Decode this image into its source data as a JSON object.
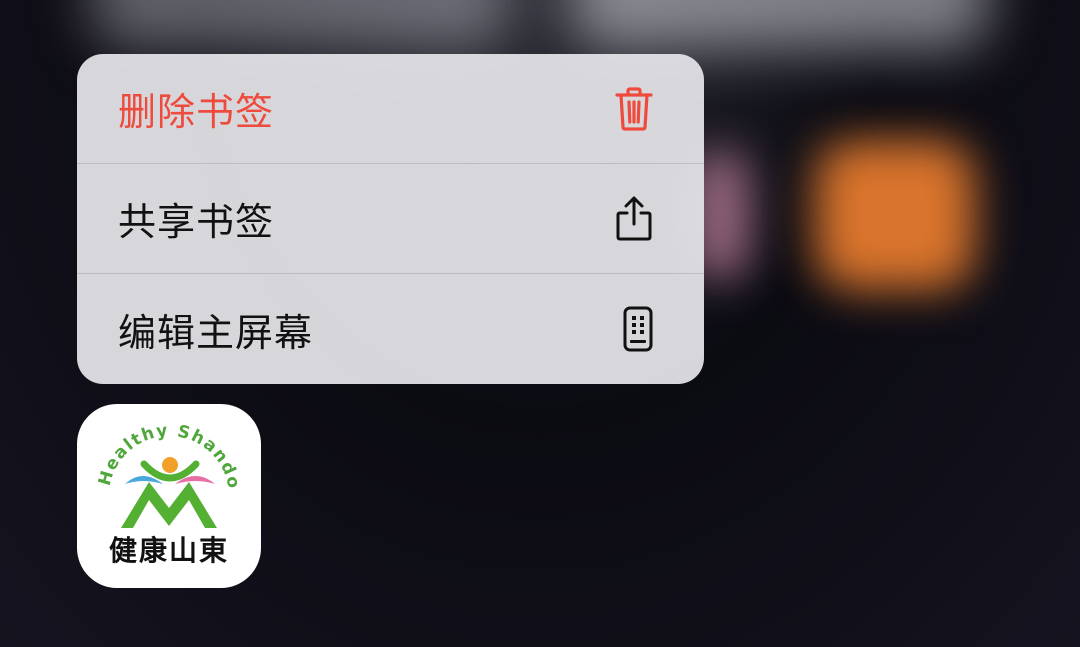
{
  "menu": {
    "items": [
      {
        "label": "删除书签",
        "icon": "trash-icon",
        "style": "destructive",
        "color": "#ee4b3c"
      },
      {
        "label": "共享书签",
        "icon": "share-icon",
        "style": "default"
      },
      {
        "label": "编辑主屏幕",
        "icon": "phone-home-screen-icon",
        "style": "default"
      }
    ]
  },
  "app": {
    "arc_text": "Healthy Shandong",
    "name_text": "健康山東",
    "logo_colors": {
      "green": "#53b032",
      "orange": "#f3a02b",
      "blue": "#4aa9dc",
      "pink": "#e86fa6"
    }
  }
}
